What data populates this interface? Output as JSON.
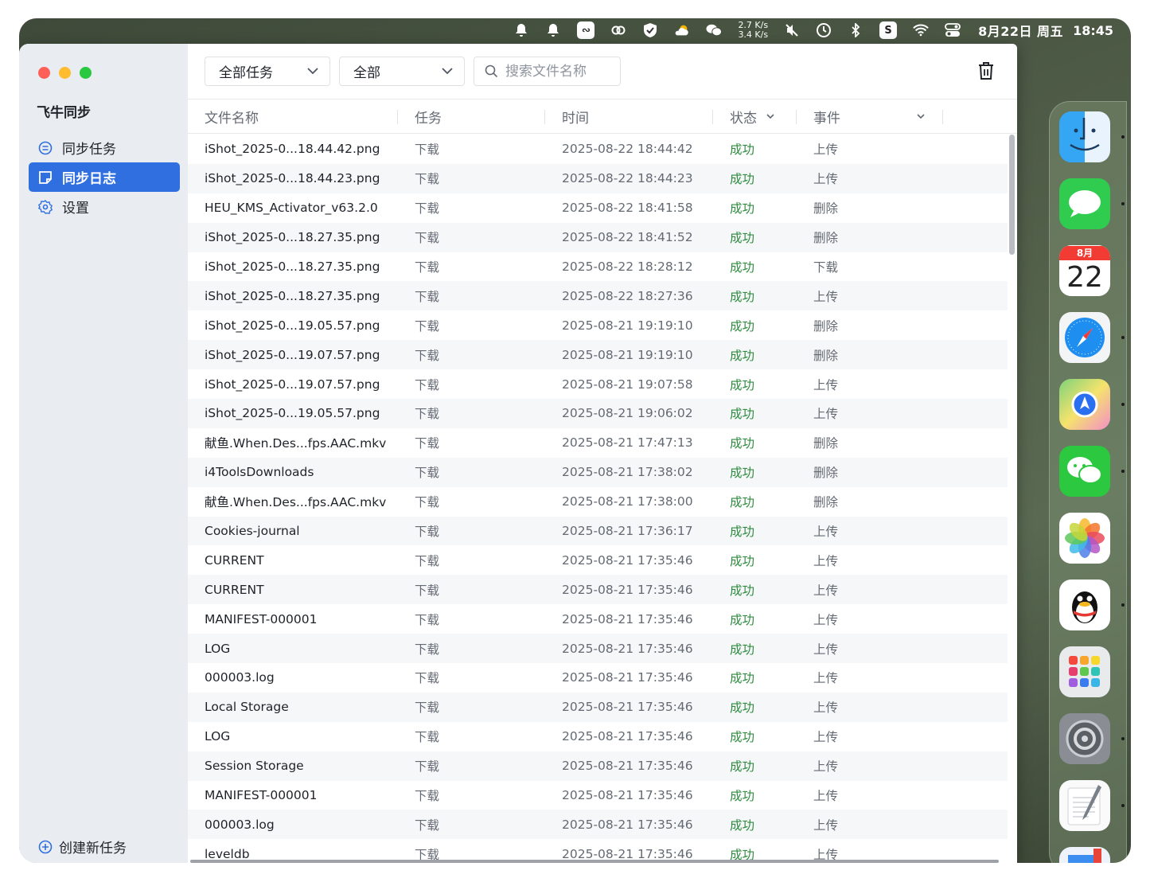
{
  "menubar": {
    "speed_up": "2.7 K/s",
    "speed_down": "3.4 K/s",
    "date": "8月22日 周五",
    "time": "18:45"
  },
  "sidebar": {
    "app_title": "飞牛同步",
    "items": [
      {
        "label": "同步任务",
        "icon": "list-circle-icon",
        "active": false
      },
      {
        "label": "同步日志",
        "icon": "note-icon",
        "active": true
      },
      {
        "label": "设置",
        "icon": "gear-icon",
        "active": false
      }
    ],
    "create_label": "创建新任务"
  },
  "toolbar": {
    "task_filter": "全部任务",
    "type_filter": "全部",
    "search_placeholder": "搜索文件名称"
  },
  "table": {
    "columns": {
      "name": "文件名称",
      "task": "任务",
      "time": "时间",
      "status": "状态",
      "event": "事件"
    },
    "rows": [
      {
        "name": "iShot_2025-0...18.44.42.png",
        "task": "下载",
        "time": "2025-08-22 18:44:42",
        "status": "成功",
        "event": "上传"
      },
      {
        "name": "iShot_2025-0...18.44.23.png",
        "task": "下载",
        "time": "2025-08-22 18:44:23",
        "status": "成功",
        "event": "上传"
      },
      {
        "name": "HEU_KMS_Activator_v63.2.0",
        "task": "下载",
        "time": "2025-08-22 18:41:58",
        "status": "成功",
        "event": "删除"
      },
      {
        "name": "iShot_2025-0...18.27.35.png",
        "task": "下载",
        "time": "2025-08-22 18:41:52",
        "status": "成功",
        "event": "删除"
      },
      {
        "name": "iShot_2025-0...18.27.35.png",
        "task": "下载",
        "time": "2025-08-22 18:28:12",
        "status": "成功",
        "event": "下载"
      },
      {
        "name": "iShot_2025-0...18.27.35.png",
        "task": "下载",
        "time": "2025-08-22 18:27:36",
        "status": "成功",
        "event": "上传"
      },
      {
        "name": "iShot_2025-0...19.05.57.png",
        "task": "下载",
        "time": "2025-08-21 19:19:10",
        "status": "成功",
        "event": "删除"
      },
      {
        "name": "iShot_2025-0...19.07.57.png",
        "task": "下载",
        "time": "2025-08-21 19:19:10",
        "status": "成功",
        "event": "删除"
      },
      {
        "name": "iShot_2025-0...19.07.57.png",
        "task": "下载",
        "time": "2025-08-21 19:07:58",
        "status": "成功",
        "event": "上传"
      },
      {
        "name": "iShot_2025-0...19.05.57.png",
        "task": "下载",
        "time": "2025-08-21 19:06:02",
        "status": "成功",
        "event": "上传"
      },
      {
        "name": "献鱼.When.Des...fps.AAC.mkv",
        "task": "下载",
        "time": "2025-08-21 17:47:13",
        "status": "成功",
        "event": "删除"
      },
      {
        "name": "i4ToolsDownloads",
        "task": "下载",
        "time": "2025-08-21 17:38:02",
        "status": "成功",
        "event": "删除"
      },
      {
        "name": "献鱼.When.Des...fps.AAC.mkv",
        "task": "下载",
        "time": "2025-08-21 17:38:00",
        "status": "成功",
        "event": "删除"
      },
      {
        "name": "Cookies-journal",
        "task": "下载",
        "time": "2025-08-21 17:36:17",
        "status": "成功",
        "event": "上传"
      },
      {
        "name": "CURRENT",
        "task": "下载",
        "time": "2025-08-21 17:35:46",
        "status": "成功",
        "event": "上传"
      },
      {
        "name": "CURRENT",
        "task": "下载",
        "time": "2025-08-21 17:35:46",
        "status": "成功",
        "event": "上传"
      },
      {
        "name": "MANIFEST-000001",
        "task": "下载",
        "time": "2025-08-21 17:35:46",
        "status": "成功",
        "event": "上传"
      },
      {
        "name": "LOG",
        "task": "下载",
        "time": "2025-08-21 17:35:46",
        "status": "成功",
        "event": "上传"
      },
      {
        "name": "000003.log",
        "task": "下载",
        "time": "2025-08-21 17:35:46",
        "status": "成功",
        "event": "上传"
      },
      {
        "name": "Local Storage",
        "task": "下载",
        "time": "2025-08-21 17:35:46",
        "status": "成功",
        "event": "上传"
      },
      {
        "name": "LOG",
        "task": "下载",
        "time": "2025-08-21 17:35:46",
        "status": "成功",
        "event": "上传"
      },
      {
        "name": "Session Storage",
        "task": "下载",
        "time": "2025-08-21 17:35:46",
        "status": "成功",
        "event": "上传"
      },
      {
        "name": "MANIFEST-000001",
        "task": "下载",
        "time": "2025-08-21 17:35:46",
        "status": "成功",
        "event": "上传"
      },
      {
        "name": "000003.log",
        "task": "下载",
        "time": "2025-08-21 17:35:46",
        "status": "成功",
        "event": "上传"
      },
      {
        "name": "leveldb",
        "task": "下载",
        "time": "2025-08-21 17:35:46",
        "status": "成功",
        "event": "上传"
      }
    ]
  },
  "dock": {
    "calendar_month": "8月",
    "calendar_day": "22",
    "apps": [
      "finder-icon",
      "messages-icon",
      "calendar-icon",
      "safari-icon",
      "maps-icon",
      "wechat-icon",
      "photos-icon",
      "qq-icon",
      "launchpad-icon",
      "system-settings-icon",
      "textedit-icon",
      "mail-icon"
    ]
  },
  "colors": {
    "accent": "#2f6fe0",
    "success": "#2e8c3e",
    "sidebar_bg": "#e9ecf0"
  }
}
